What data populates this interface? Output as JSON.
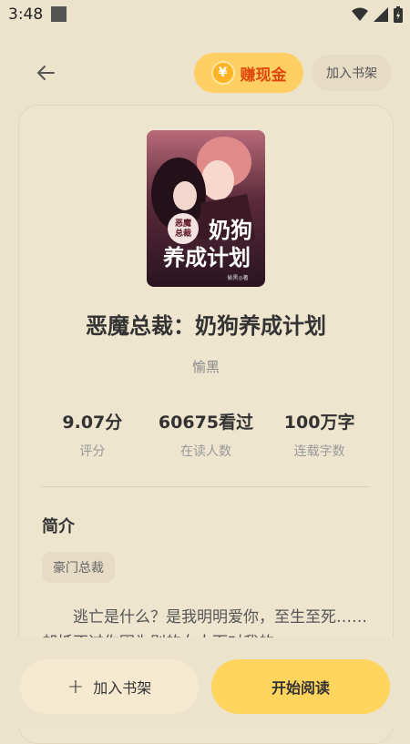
{
  "status_bar": {
    "time": "3:48"
  },
  "header": {
    "earn_label": "赚现金",
    "coin_symbol": "¥",
    "add_shelf_label": "加入书架"
  },
  "book": {
    "cover": {
      "badge": "恶魔总裁",
      "title_line1": "奶狗",
      "title_line2": "养成计划",
      "author_small": "偷黑◎著"
    },
    "title": "恶魔总裁：奶狗养成计划",
    "author": "愉黑",
    "stats": [
      {
        "value": "9.07分",
        "label": "评分"
      },
      {
        "value": "60675看过",
        "label": "在读人数"
      },
      {
        "value": "100万字",
        "label": "连载字数"
      }
    ],
    "intro_heading": "简介",
    "tag": "豪门总裁",
    "synopsis": "逃亡是什么？是我明明爱你，至生至死……却抵不过你因为别的女人而对我的"
  },
  "bottom": {
    "plus": "+",
    "add_shelf": "加入书架",
    "start_reading": "开始阅读"
  },
  "colors": {
    "background": "#ece3cc",
    "accent": "#ffd55e",
    "earn_text": "#e0460c"
  }
}
